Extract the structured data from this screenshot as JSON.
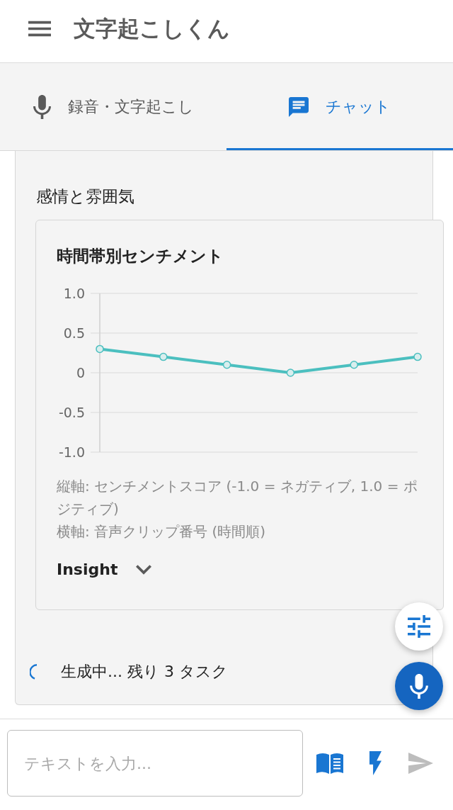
{
  "app_bar": {
    "title": "文字起こしくん"
  },
  "tabs": [
    {
      "kind": "record",
      "label": "録音・文字起こし",
      "selected": false
    },
    {
      "kind": "chat",
      "label": "チャット",
      "selected": true
    }
  ],
  "section": {
    "heading": "感情と雰囲気",
    "chart_card": {
      "chart_data": {
        "type": "line",
        "title": "時間帯別センチメント",
        "grid": true,
        "series": [
          {
            "color": "#4bbfbf",
            "marker": "circle",
            "values": [
              0.3,
              0.2,
              0.1,
              0,
              0.1,
              0.2
            ]
          }
        ],
        "ylim": [
          -1,
          1
        ],
        "yticks": [
          {
            "value": -1,
            "label": "-1.0"
          },
          {
            "value": -0.5,
            "label": "-0.5"
          },
          {
            "value": 0,
            "label": "0"
          },
          {
            "value": 0.5,
            "label": "0.5"
          },
          {
            "value": 1,
            "label": "1.0"
          }
        ]
      },
      "notes": [
        "縦軸: センチメントスコア (-1.0 = ネガティブ, 1.0 = ポジティブ)",
        "横軸: 音声クリップ番号 (時間順)"
      ],
      "insight": {
        "label": "Insight",
        "expanded": false
      }
    },
    "status": "生成中... 残り 3 タスク"
  },
  "composer": {
    "placeholder": "テキストを入力...",
    "send_disabled": true
  }
}
